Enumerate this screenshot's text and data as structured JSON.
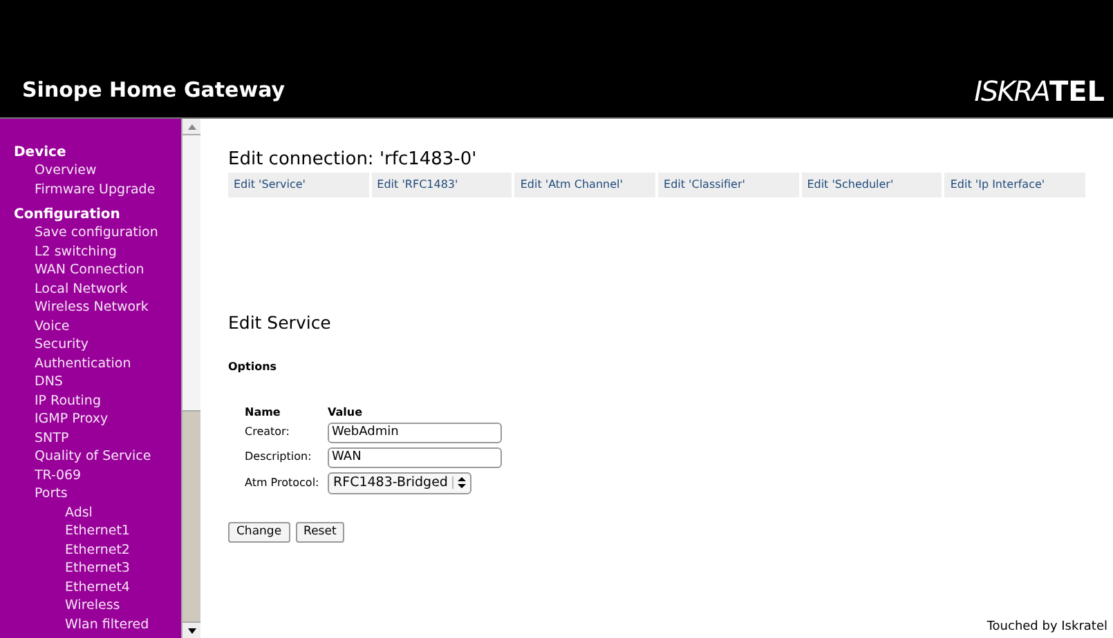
{
  "header": {
    "title": "Sinope Home Gateway",
    "logo": {
      "light": "ISKRA",
      "bold": "TEL"
    }
  },
  "sidebar": {
    "sections": [
      {
        "label": "Device",
        "items": [
          {
            "label": "Overview"
          },
          {
            "label": "Firmware Upgrade"
          }
        ]
      },
      {
        "label": "Configuration",
        "items": [
          {
            "label": "Save configuration"
          },
          {
            "label": "L2 switching"
          },
          {
            "label": "WAN Connection"
          },
          {
            "label": "Local Network"
          },
          {
            "label": "Wireless Network"
          },
          {
            "label": "Voice"
          },
          {
            "label": "Security"
          },
          {
            "label": "Authentication"
          },
          {
            "label": "DNS"
          },
          {
            "label": "IP Routing"
          },
          {
            "label": "IGMP Proxy"
          },
          {
            "label": "SNTP"
          },
          {
            "label": "Quality of Service"
          },
          {
            "label": "TR-069"
          },
          {
            "label": "Ports",
            "children": [
              {
                "label": "Adsl"
              },
              {
                "label": "Ethernet1"
              },
              {
                "label": "Ethernet2"
              },
              {
                "label": "Ethernet3"
              },
              {
                "label": "Ethernet4"
              },
              {
                "label": "Wireless"
              },
              {
                "label": "Wlan filtered"
              }
            ]
          }
        ]
      }
    ]
  },
  "main": {
    "title": "Edit connection: 'rfc1483-0'",
    "tabs": [
      "Edit 'Service'",
      "Edit 'RFC1483'",
      "Edit 'Atm Channel'",
      "Edit 'Classifier'",
      "Edit 'Scheduler'",
      "Edit 'Ip Interface'"
    ],
    "section_title": "Edit Service",
    "subtitle": "Options",
    "columns": [
      "Name",
      "Value"
    ],
    "fields": [
      {
        "kind": "text",
        "label": "Creator:",
        "value": "WebAdmin"
      },
      {
        "kind": "text",
        "label": "Description:",
        "value": "WAN"
      },
      {
        "kind": "select",
        "label": "Atm Protocol:",
        "value": "RFC1483-Bridged"
      }
    ],
    "buttons": [
      "Change",
      "Reset"
    ]
  },
  "footer": "Touched by Iskratel"
}
